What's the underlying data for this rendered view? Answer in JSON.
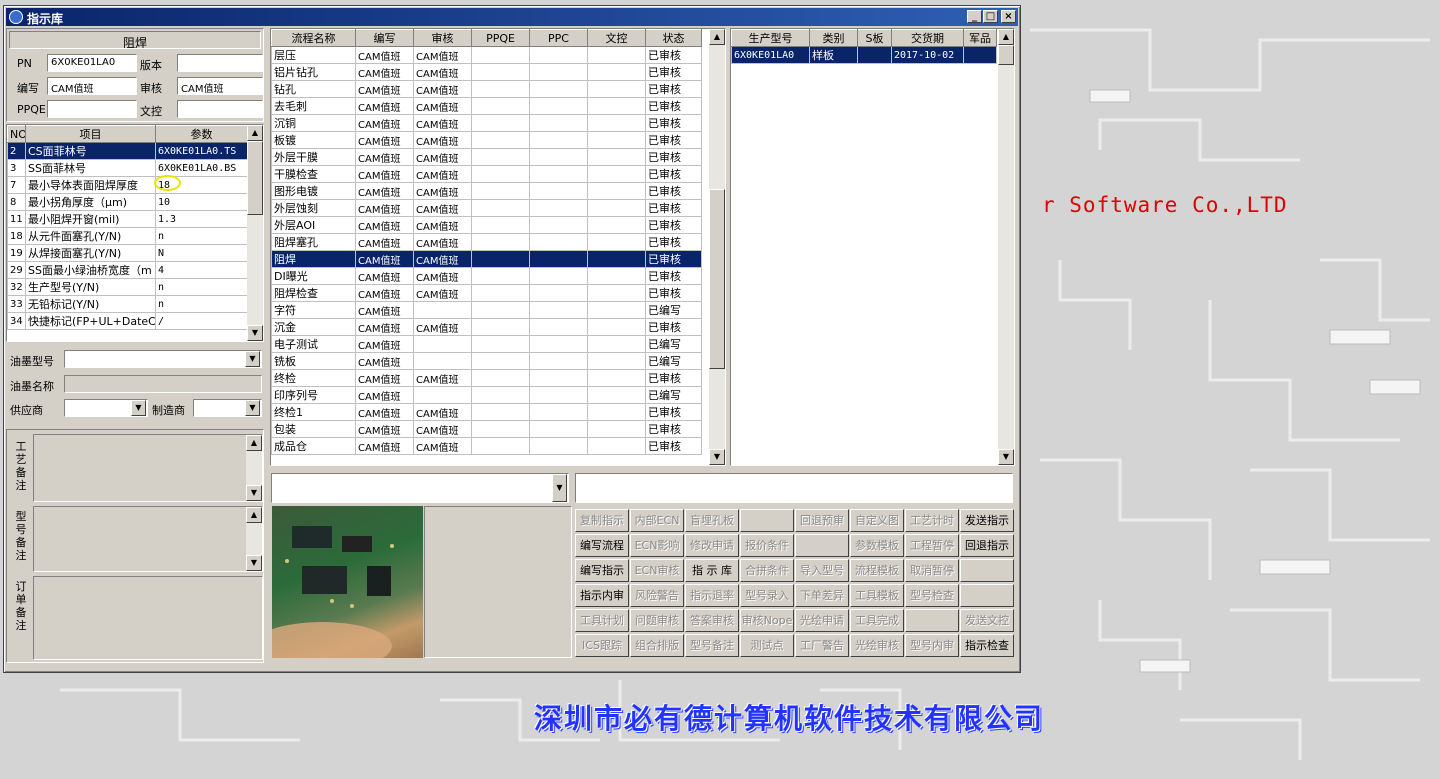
{
  "window": {
    "title": "指示库",
    "min_icon": "minimize-icon",
    "max_icon": "maximize-icon",
    "close_icon": "close-icon"
  },
  "desktop": {
    "watermark_en": "r Software Co.,LTD",
    "watermark_cn": "深圳市必有德计算机软件技术有限公司"
  },
  "left": {
    "process_title": "阻焊",
    "fields": {
      "pn_label": "PN",
      "pn_value": "6X0KE01LA0",
      "version_label": "版本",
      "version_value": "",
      "write_label": "编写",
      "write_value": "CAM值班",
      "review_label": "审核",
      "review_value": "CAM值班",
      "ppqe_label": "PPQE",
      "ppqe_value": "",
      "doc_control_label": "文控",
      "doc_control_value": ""
    },
    "param_headers": [
      "NO",
      "项目",
      "参数"
    ],
    "params": [
      {
        "no": "2",
        "item": "CS面菲林号",
        "value": "6X0KE01LA0.TS",
        "selected": true
      },
      {
        "no": "3",
        "item": "SS面菲林号",
        "value": "6X0KE01LA0.BS"
      },
      {
        "no": "7",
        "item": "最小导体表面阻焊厚度",
        "value": "18"
      },
      {
        "no": "8",
        "item": "最小拐角厚度（μm)",
        "value": "10"
      },
      {
        "no": "11",
        "item": "最小阻焊开窗(mil)",
        "value": "1.3"
      },
      {
        "no": "18",
        "item": "从元件面塞孔(Y/N)",
        "value": "n"
      },
      {
        "no": "19",
        "item": "从焊接面塞孔(Y/N)",
        "value": "N"
      },
      {
        "no": "29",
        "item": "SS面最小绿油桥宽度（m",
        "value": "4"
      },
      {
        "no": "32",
        "item": "生产型号(Y/N)",
        "value": "n"
      },
      {
        "no": "33",
        "item": "无铅标记(Y/N)",
        "value": "n"
      },
      {
        "no": "34",
        "item": "快捷标记(FP+UL+DateCo",
        "value": "/"
      }
    ],
    "ink_type_label": "油墨型号",
    "ink_type_value": "",
    "ink_name_label": "油墨名称",
    "ink_name_value": "",
    "supplier_label": "供应商",
    "supplier_value": "",
    "maker_label": "制造商",
    "maker_value": "",
    "craft_note_label": "工艺备注",
    "model_note_label": "型号备注",
    "order_note_label": "订单备注"
  },
  "flow": {
    "headers": [
      "流程名称",
      "编写",
      "审核",
      "PPQE",
      "PPC",
      "文控",
      "状态"
    ],
    "rows": [
      {
        "name": "层压",
        "write": "CAM值班",
        "review": "CAM值班",
        "status": "已审核"
      },
      {
        "name": "铝片钻孔",
        "write": "CAM值班",
        "review": "CAM值班",
        "status": "已审核"
      },
      {
        "name": "钻孔",
        "write": "CAM值班",
        "review": "CAM值班",
        "status": "已审核"
      },
      {
        "name": "去毛刺",
        "write": "CAM值班",
        "review": "CAM值班",
        "status": "已审核"
      },
      {
        "name": "沉铜",
        "write": "CAM值班",
        "review": "CAM值班",
        "status": "已审核"
      },
      {
        "name": "板镀",
        "write": "CAM值班",
        "review": "CAM值班",
        "status": "已审核"
      },
      {
        "name": "外层干膜",
        "write": "CAM值班",
        "review": "CAM值班",
        "status": "已审核"
      },
      {
        "name": "干膜检查",
        "write": "CAM值班",
        "review": "CAM值班",
        "status": "已审核"
      },
      {
        "name": "图形电镀",
        "write": "CAM值班",
        "review": "CAM值班",
        "status": "已审核"
      },
      {
        "name": "外层蚀刻",
        "write": "CAM值班",
        "review": "CAM值班",
        "status": "已审核"
      },
      {
        "name": "外层AOI",
        "write": "CAM值班",
        "review": "CAM值班",
        "status": "已审核"
      },
      {
        "name": "阻焊塞孔",
        "write": "CAM值班",
        "review": "CAM值班",
        "status": "已审核"
      },
      {
        "name": "阻焊",
        "write": "CAM值班",
        "review": "CAM值班",
        "status": "已审核",
        "selected": true
      },
      {
        "name": "DI曝光",
        "write": "CAM值班",
        "review": "CAM值班",
        "status": "已审核"
      },
      {
        "name": "阻焊检查",
        "write": "CAM值班",
        "review": "CAM值班",
        "status": "已审核"
      },
      {
        "name": "字符",
        "write": "CAM值班",
        "review": "",
        "status": "已编写"
      },
      {
        "name": "沉金",
        "write": "CAM值班",
        "review": "CAM值班",
        "status": "已审核"
      },
      {
        "name": "电子测试",
        "write": "CAM值班",
        "review": "",
        "status": "已编写"
      },
      {
        "name": "铣板",
        "write": "CAM值班",
        "review": "",
        "status": "已编写"
      },
      {
        "name": "终检",
        "write": "CAM值班",
        "review": "CAM值班",
        "status": "已审核"
      },
      {
        "name": "印序列号",
        "write": "CAM值班",
        "review": "",
        "status": "已编写"
      },
      {
        "name": "终检1",
        "write": "CAM值班",
        "review": "CAM值班",
        "status": "已审核"
      },
      {
        "name": "包装",
        "write": "CAM值班",
        "review": "CAM值班",
        "status": "已审核"
      },
      {
        "name": "成品仓",
        "write": "CAM值班",
        "review": "CAM值班",
        "status": "已审核"
      }
    ]
  },
  "production": {
    "headers": [
      "生产型号",
      "类别",
      "S板",
      "交货期",
      "军品"
    ],
    "rows": [
      {
        "model": "6X0KE01LA0",
        "type": "样板",
        "s": "",
        "due": "2017-10-02",
        "mil": "",
        "selected": true
      }
    ]
  },
  "buttons": [
    [
      {
        "label": "复制指示",
        "enabled": false
      },
      {
        "label": "内部ECN",
        "enabled": false
      },
      {
        "label": "盲埋孔板",
        "enabled": false
      },
      {
        "label": "",
        "enabled": false
      },
      {
        "label": "回退预审",
        "enabled": false
      },
      {
        "label": "自定义图",
        "enabled": false
      },
      {
        "label": "工艺计时",
        "enabled": false
      },
      {
        "label": "发送指示",
        "enabled": true
      }
    ],
    [
      {
        "label": "编写流程",
        "enabled": true
      },
      {
        "label": "ECN影响",
        "enabled": false
      },
      {
        "label": "修改申请",
        "enabled": false
      },
      {
        "label": "报价条件",
        "enabled": false
      },
      {
        "label": "",
        "enabled": false
      },
      {
        "label": "参数模板",
        "enabled": false
      },
      {
        "label": "工程暂停",
        "enabled": false
      },
      {
        "label": "回退指示",
        "enabled": true
      }
    ],
    [
      {
        "label": "编写指示",
        "enabled": true
      },
      {
        "label": "ECN审核",
        "enabled": false
      },
      {
        "label": "指 示 库",
        "enabled": true
      },
      {
        "label": "合拼条件",
        "enabled": false
      },
      {
        "label": "导入型号",
        "enabled": false
      },
      {
        "label": "流程模板",
        "enabled": false
      },
      {
        "label": "取消暂停",
        "enabled": false
      },
      {
        "label": "",
        "enabled": false
      }
    ],
    [
      {
        "label": "指示内审",
        "enabled": true
      },
      {
        "label": "风险警告",
        "enabled": false
      },
      {
        "label": "指示退率",
        "enabled": false
      },
      {
        "label": "型号录入",
        "enabled": false
      },
      {
        "label": "下单差异",
        "enabled": false
      },
      {
        "label": "工具模板",
        "enabled": false
      },
      {
        "label": "型号检查",
        "enabled": false
      },
      {
        "label": "",
        "enabled": false
      }
    ],
    [
      {
        "label": "工具计划",
        "enabled": false
      },
      {
        "label": "问题审核",
        "enabled": false
      },
      {
        "label": "答案审核",
        "enabled": false
      },
      {
        "label": "审核Nope",
        "enabled": false
      },
      {
        "label": "光绘申请",
        "enabled": false
      },
      {
        "label": "工具完成",
        "enabled": false
      },
      {
        "label": "",
        "enabled": false
      },
      {
        "label": "发送文控",
        "enabled": false
      }
    ],
    [
      {
        "label": "ICS跟踪",
        "enabled": false
      },
      {
        "label": "组合排版",
        "enabled": false
      },
      {
        "label": "型号备注",
        "enabled": false
      },
      {
        "label": "测试点",
        "enabled": false
      },
      {
        "label": "工厂警告",
        "enabled": false
      },
      {
        "label": "光绘审核",
        "enabled": false
      },
      {
        "label": "型号内审",
        "enabled": false
      },
      {
        "label": "指示检查",
        "enabled": true
      }
    ]
  ]
}
